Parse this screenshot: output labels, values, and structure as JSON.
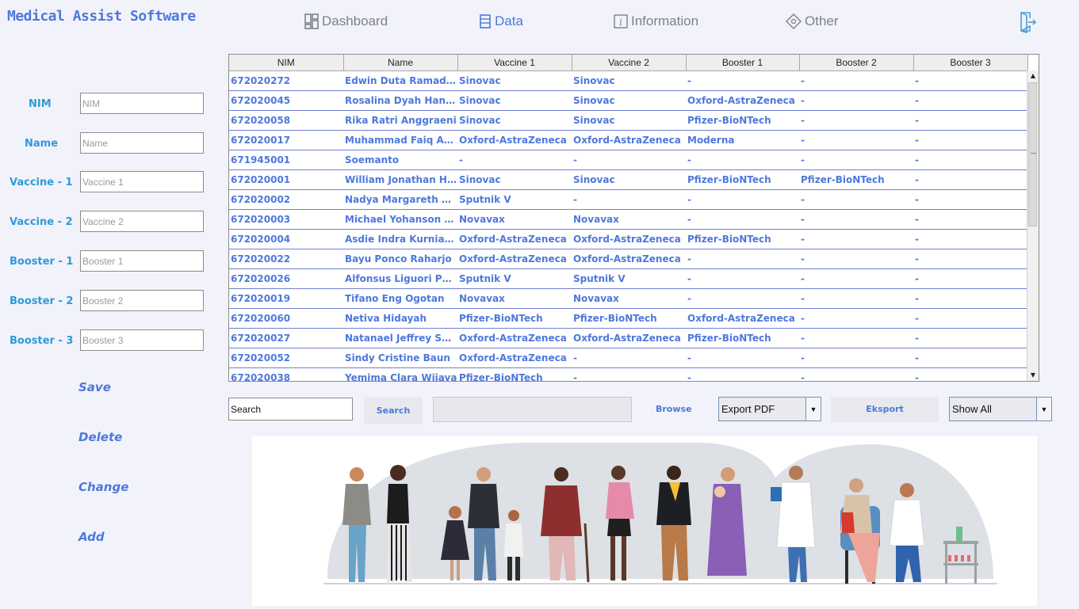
{
  "app": {
    "title": "Medical Assist Software"
  },
  "nav": {
    "dashboard": "Dashboard",
    "data": "Data",
    "information": "Information",
    "other": "Other"
  },
  "form": {
    "fields": [
      {
        "label": "NIM",
        "placeholder": "NIM"
      },
      {
        "label": "Name",
        "placeholder": "Name"
      },
      {
        "label": "Vaccine - 1",
        "placeholder": "Vaccine 1"
      },
      {
        "label": "Vaccine - 2",
        "placeholder": "Vaccine 2"
      },
      {
        "label": "Booster - 1",
        "placeholder": "Booster 1"
      },
      {
        "label": "Booster - 2",
        "placeholder": "Booster 2"
      },
      {
        "label": "Booster - 3",
        "placeholder": "Booster 3"
      }
    ],
    "actions": {
      "save": "Save",
      "delete": "Delete",
      "change": "Change",
      "add": "Add"
    }
  },
  "table": {
    "columns": [
      "NIM",
      "Name",
      "Vaccine 1",
      "Vaccine 2",
      "Booster 1",
      "Booster 2",
      "Booster 3"
    ],
    "rows": [
      [
        "672020272",
        "Edwin Duta Ramadhan",
        "Sinovac",
        "Sinovac",
        "-",
        "-",
        "-"
      ],
      [
        "672020045",
        "Rosalina Dyah Handika",
        "Sinovac",
        "Sinovac",
        "Oxford-AstraZeneca",
        "-",
        "-"
      ],
      [
        "672020058",
        "Rika Ratri Anggraeni",
        "Sinovac",
        "Sinovac",
        "Pfizer-BioNTech",
        "-",
        "-"
      ],
      [
        "672020017",
        "Muhammad Faiq Adh...",
        "Oxford-AstraZeneca",
        "Oxford-AstraZeneca",
        "Moderna",
        "-",
        "-"
      ],
      [
        "671945001",
        "Soemanto",
        "-",
        "-",
        "-",
        "-",
        "-"
      ],
      [
        "672020001",
        "William Jonathan Ha...",
        "Sinovac",
        "Sinovac",
        "Pfizer-BioNTech",
        "Pfizer-BioNTech",
        "-"
      ],
      [
        "672020002",
        "Nadya Margareth Ang...",
        "Sputnik V",
        "-",
        "-",
        "-",
        "-"
      ],
      [
        "672020003",
        "Michael Yohanson M...",
        "Novavax",
        "Novavax",
        "-",
        "-",
        "-"
      ],
      [
        "672020004",
        "Asdie Indra Kurniawan",
        "Oxford-AstraZeneca",
        "Oxford-AstraZeneca",
        "Pfizer-BioNTech",
        "-",
        "-"
      ],
      [
        "672020022",
        "Bayu Ponco Raharjo",
        "Oxford-AstraZeneca",
        "Oxford-AstraZeneca",
        "-",
        "-",
        "-"
      ],
      [
        "672020026",
        "Alfonsus Liguori Pent...",
        "Sputnik V",
        "Sputnik V",
        "-",
        "-",
        "-"
      ],
      [
        "672020019",
        "Tifano Eng Ogotan",
        "Novavax",
        "Novavax",
        "-",
        "-",
        "-"
      ],
      [
        "672020060",
        "Netiva Hidayah",
        "Pfizer-BioNTech",
        "Pfizer-BioNTech",
        "Oxford-AstraZeneca",
        "-",
        "-"
      ],
      [
        "672020027",
        "Natanael Jeffrey Sus...",
        "Oxford-AstraZeneca",
        "Oxford-AstraZeneca",
        "Pfizer-BioNTech",
        "-",
        "-"
      ],
      [
        "672020052",
        "Sindy Cristine Baun",
        "Oxford-AstraZeneca",
        "-",
        "-",
        "-",
        "-"
      ],
      [
        "672020038",
        "Yemima Clara Wijaya",
        "Pfizer-BioNTech",
        "-",
        "-",
        "-",
        "-"
      ]
    ]
  },
  "toolbar": {
    "search_value": "Search",
    "search_button": "Search",
    "browse": "Browse",
    "export_format": "Export PDF",
    "export_button": "Eksport",
    "filter": "Show All"
  },
  "colors": {
    "accent": "#4e78dc",
    "label": "#2f9ad6",
    "background": "#f2f3fa"
  }
}
